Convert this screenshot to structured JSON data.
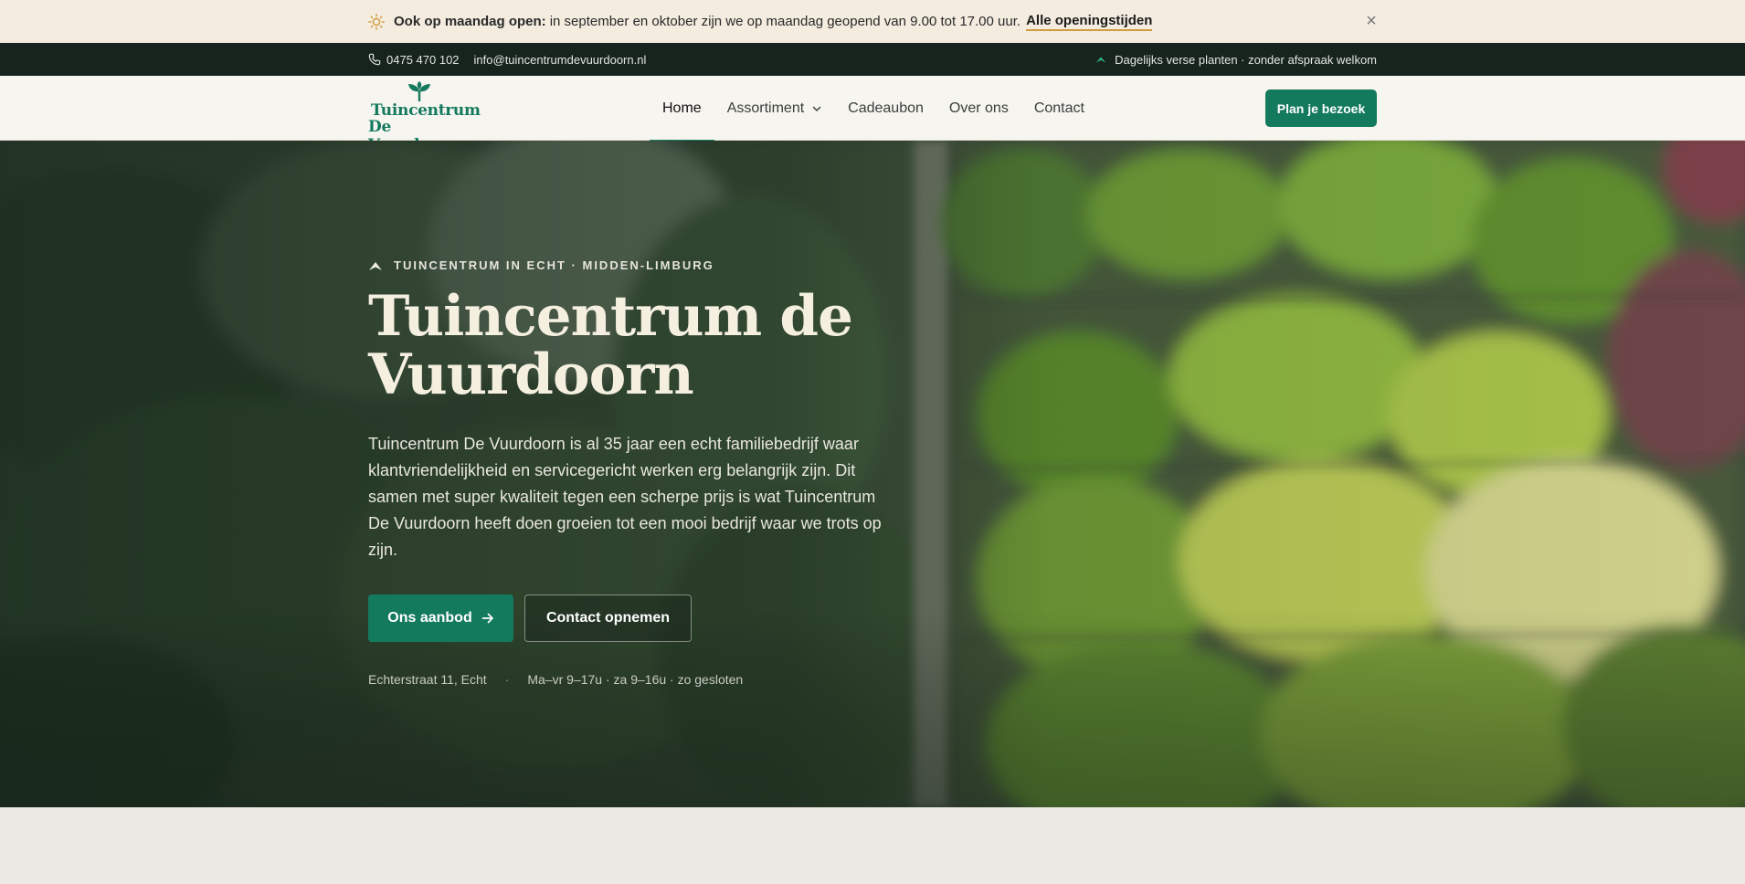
{
  "announcement": {
    "bold": "Ook op maandag open:",
    "text": "in september en oktober zijn we op maandag geopend van 9.00 tot 17.00 uur.",
    "link": "Alle openingstijden",
    "close": "×"
  },
  "contact_strip": {
    "phone": "0475 470 102",
    "email": "info@tuincentrumdevuurdoorn.nl",
    "tagline": "Dagelijks verse planten · zonder afspraak welkom"
  },
  "logo": {
    "line1": "Tuincentrum",
    "line2": "De Vuurdoorn"
  },
  "nav": {
    "items": [
      {
        "label": "Home"
      },
      {
        "label": "Assortiment"
      },
      {
        "label": "Cadeaubon"
      },
      {
        "label": "Over ons"
      },
      {
        "label": "Contact"
      }
    ],
    "active": "Home"
  },
  "header_cta": "Plan je bezoek",
  "hero": {
    "kicker": "TUINCENTRUM IN ECHT · MIDDEN-LIMBURG",
    "title": "Tuincentrum de Vuurdoorn",
    "description": "Tuincentrum De Vuurdoorn is al 35 jaar een echt familiebedrijf waar klantvriendelijkheid en servicegericht werken erg belangrijk zijn. Dit samen met super kwaliteit tegen een scherpe prijs is wat Tuincentrum De Vuurdoorn heeft doen groeien tot een mooi bedrijf waar we trots op zijn.",
    "primary_button": "Ons aanbod",
    "secondary_button": "Contact opnemen",
    "address": "Echterstraat 11, Echt",
    "separator": "·",
    "hours": "Ma–vr 9–17u · za 9–16u · zo gesloten"
  },
  "colors": {
    "brand_green": "#147a5e",
    "dark_strip": "#17241d",
    "announce_bg": "#f3ecdf",
    "link_underline": "#d19a3b"
  },
  "icons": [
    "sun-icon",
    "phone-icon",
    "leaf-icon",
    "chevron-down-icon",
    "arrow-right-icon",
    "close-icon",
    "sprout-logo-icon"
  ]
}
